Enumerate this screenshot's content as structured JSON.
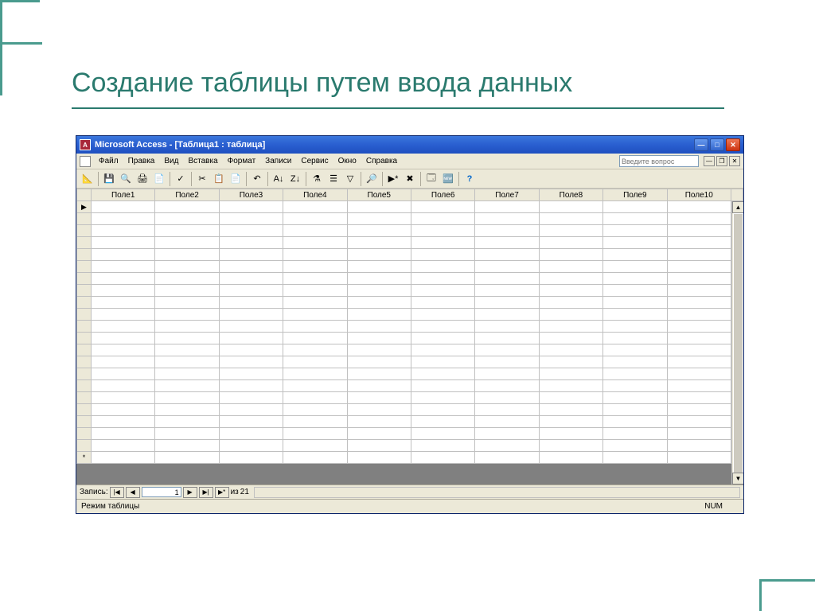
{
  "slide": {
    "title": "Создание таблицы путем ввода данных"
  },
  "window": {
    "title": "Microsoft Access - [Таблица1 : таблица]"
  },
  "menus": {
    "file": "Файл",
    "edit": "Правка",
    "view": "Вид",
    "insert": "Вставка",
    "format": "Формат",
    "records": "Записи",
    "tools": "Сервис",
    "window": "Окно",
    "help": "Справка"
  },
  "help_placeholder": "Введите вопрос",
  "columns": [
    "Поле1",
    "Поле2",
    "Поле3",
    "Поле4",
    "Поле5",
    "Поле6",
    "Поле7",
    "Поле8",
    "Поле9",
    "Поле10"
  ],
  "record_nav": {
    "label": "Запись:",
    "current": "1",
    "of_label": "из",
    "total": "21"
  },
  "status": {
    "mode": "Режим таблицы",
    "num": "NUM"
  },
  "icons": {
    "minimize": "—",
    "maximize": "□",
    "close": "✕",
    "restore": "❐",
    "first": "|◀",
    "prev": "◀",
    "next": "▶",
    "last": "▶|",
    "new": "▶*",
    "up": "▲",
    "down": "▼",
    "record_current": "▶",
    "record_new": "*"
  }
}
